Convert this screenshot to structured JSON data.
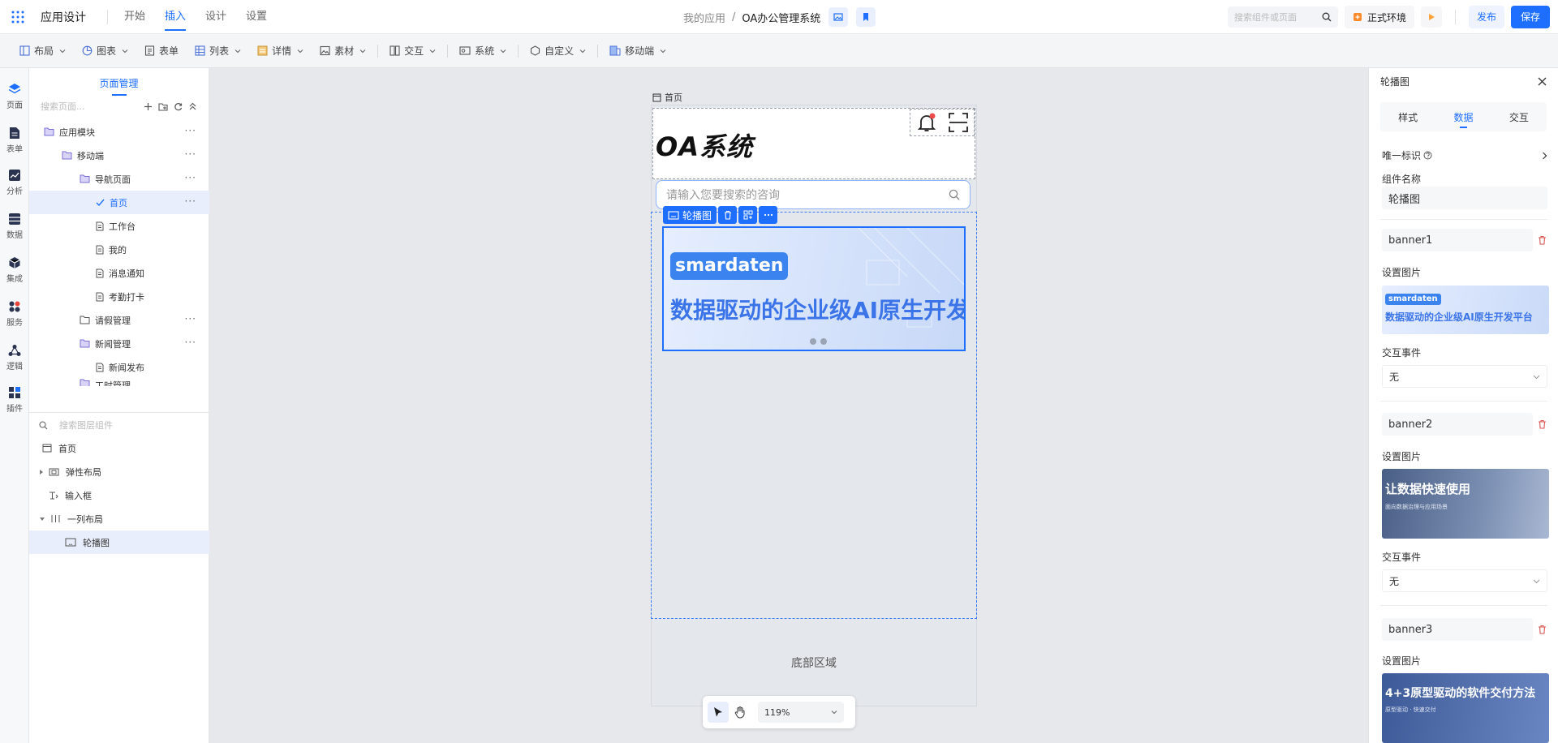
{
  "app": {
    "title": "应用设计",
    "tabs": [
      "开始",
      "插入",
      "设计",
      "设置"
    ],
    "active_tab": 1
  },
  "breadcrumb": {
    "root": "我的应用",
    "current": "OA办公管理系统"
  },
  "topright": {
    "search_placeholder": "搜索组件或页面",
    "env_label": "正式环境",
    "publish": "发布",
    "save": "保存"
  },
  "toolbar": [
    "布局",
    "图表",
    "表单",
    "列表",
    "详情",
    "素材",
    "交互",
    "系统",
    "自定义",
    "移动端"
  ],
  "rail": [
    "页面",
    "表单",
    "分析",
    "数据",
    "集成",
    "服务",
    "逻辑",
    "插件"
  ],
  "pages": {
    "title": "页面管理",
    "search_placeholder": "搜索页面...",
    "tree": [
      "应用模块",
      "移动端",
      "导航页面",
      "首页",
      "工作台",
      "我的",
      "消息通知",
      "考勤打卡",
      "请假管理",
      "新闻管理",
      "新闻发布",
      "工时管理"
    ]
  },
  "layers": {
    "search_placeholder": "搜索图层组件",
    "items": [
      "首页",
      "弹性布局",
      "输入框",
      "一列布局",
      "轮播图"
    ]
  },
  "canvas": {
    "page_label": "首页",
    "brand": "OA系统",
    "search_placeholder": "请输入您要搜索的咨询",
    "component_tag": "轮播图",
    "banner_pill": "smardaten",
    "banner_text": "数据驱动的企业级AI原生开发平台",
    "footer": "底部区域",
    "zoom": "119%"
  },
  "rpanel": {
    "title": "轮播图",
    "tabs": [
      "样式",
      "数据",
      "交互"
    ],
    "active_tab": 1,
    "unique_id": "唯一标识",
    "comp_name_label": "组件名称",
    "comp_name_value": "轮播图",
    "set_image": "设置图片",
    "event_label": "交互事件",
    "event_value": "无",
    "banners": [
      {
        "name": "banner1",
        "thumb_pill": "smardaten",
        "thumb_title": "数据驱动的企业级AI原生开发平台",
        "thumb_sub": ""
      },
      {
        "name": "banner2",
        "thumb_pill": "",
        "thumb_title": "让数据快速使用",
        "thumb_sub": "面向数据治理与应用场景"
      },
      {
        "name": "banner3",
        "thumb_pill": "",
        "thumb_title": "4+3原型驱动的软件交付方法",
        "thumb_sub": "原型驱动 · 快速交付"
      }
    ]
  },
  "colors": {
    "accent": "#1e6fff",
    "selection": "#e8eefb",
    "canvas_bg": "#e6e8ec"
  }
}
